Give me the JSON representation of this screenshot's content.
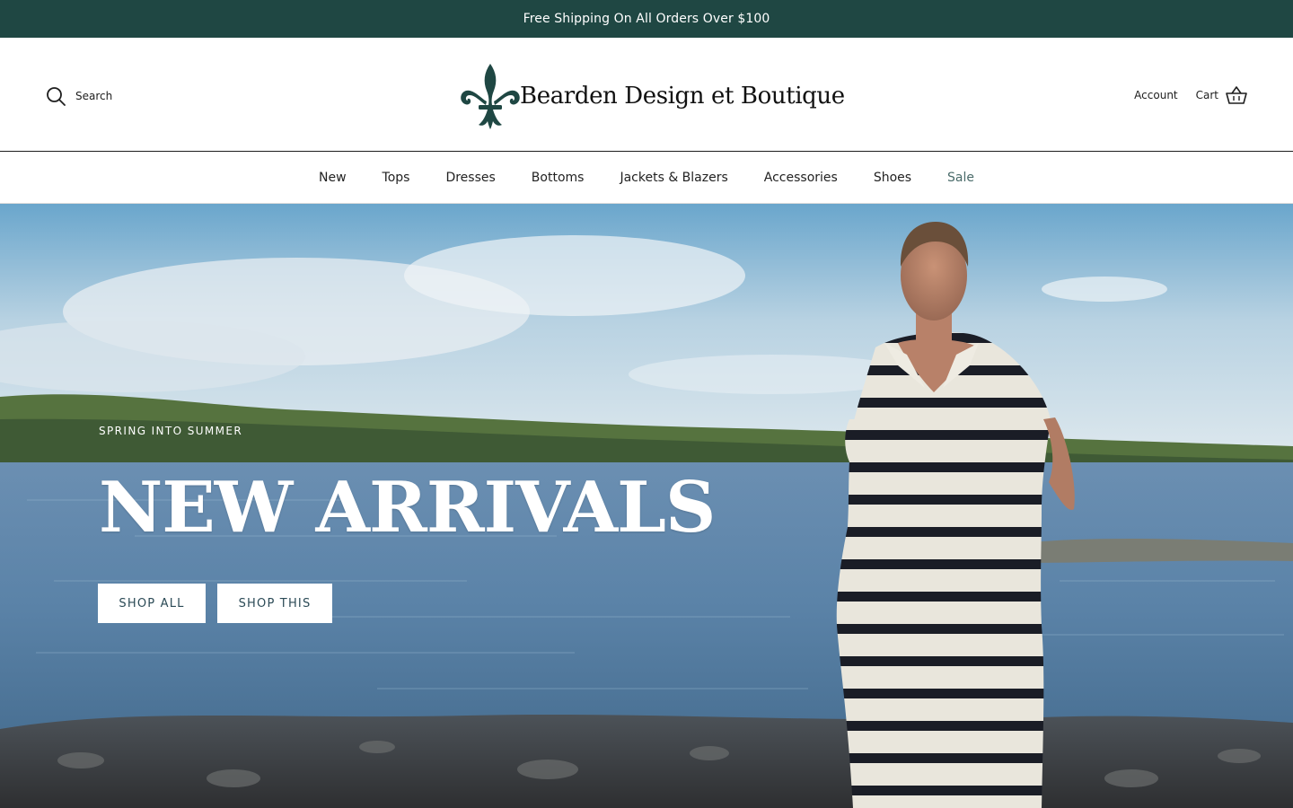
{
  "announcement": {
    "text": "Free Shipping On All Orders Over $100"
  },
  "header": {
    "search_label": "Search",
    "brand_name": "Bearden Design et Boutique",
    "account_label": "Account",
    "cart_label": "Cart"
  },
  "nav": {
    "items": [
      {
        "label": "New"
      },
      {
        "label": "Tops"
      },
      {
        "label": "Dresses"
      },
      {
        "label": "Bottoms"
      },
      {
        "label": "Jackets & Blazers"
      },
      {
        "label": "Accessories"
      },
      {
        "label": "Shoes"
      },
      {
        "label": "Sale"
      }
    ]
  },
  "hero": {
    "eyebrow": "SPRING INTO SUMMER",
    "title": "NEW ARRIVALS",
    "buttons": {
      "shop_all": "SHOP ALL",
      "shop_this": "SHOP THIS"
    }
  },
  "colors": {
    "announcement_bg": "#1f4743",
    "logo_green": "#1f4743",
    "sale_link": "#4a6b6a",
    "button_text": "#2b4a56"
  },
  "icons": {
    "search": "search-icon",
    "cart": "basket-icon",
    "logo": "fleur-de-lis-icon"
  }
}
